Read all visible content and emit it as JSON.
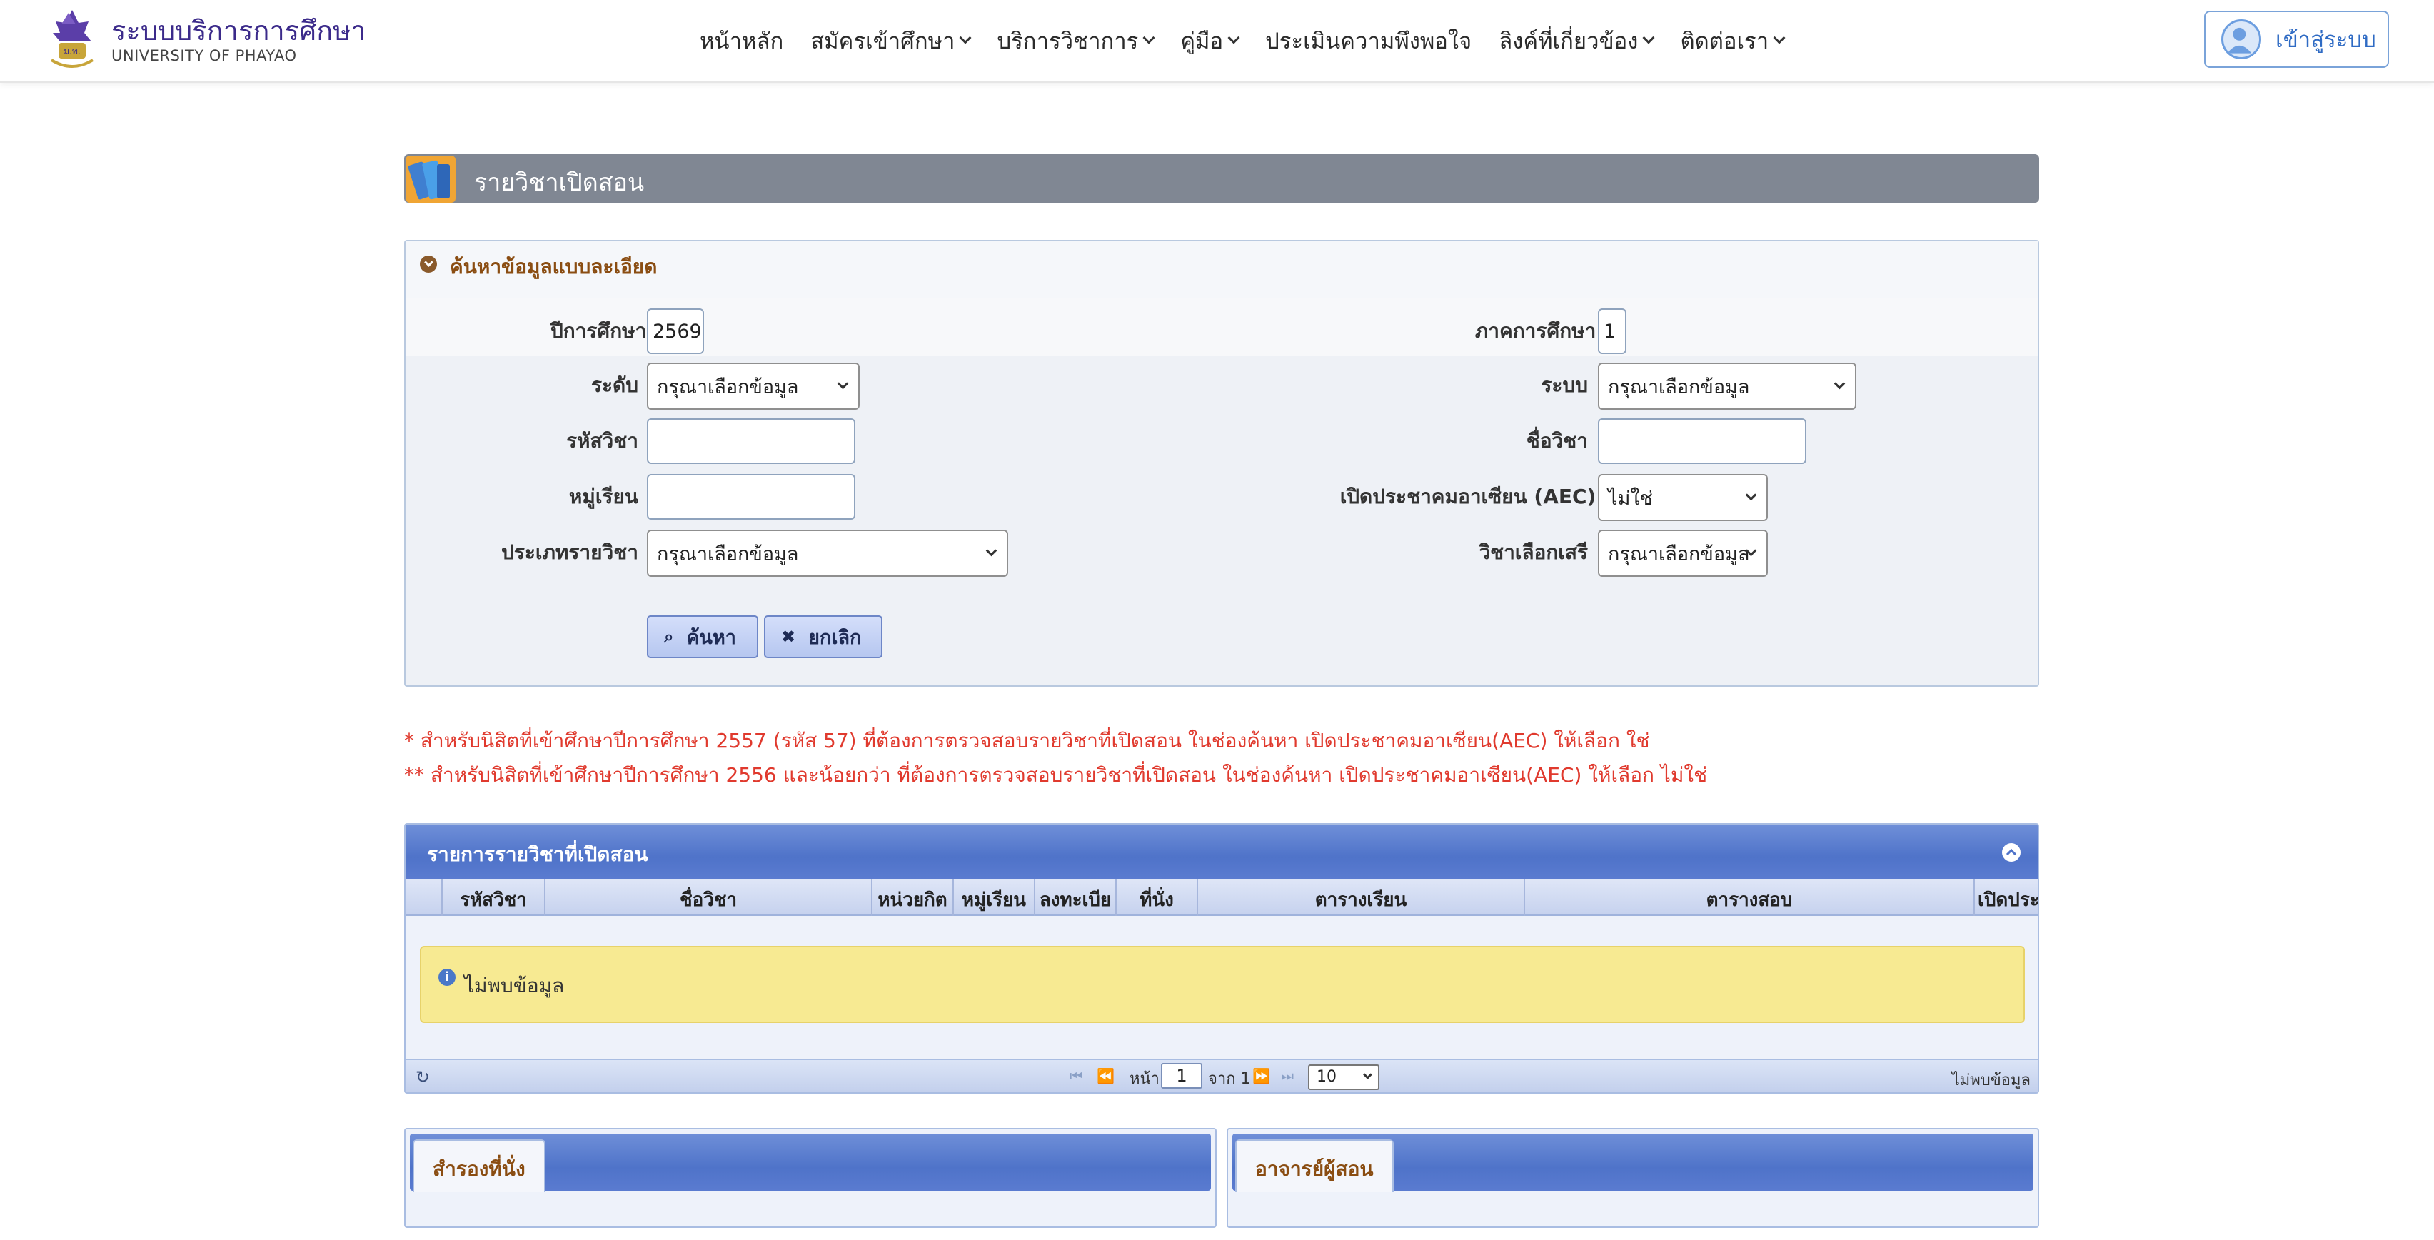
{
  "header": {
    "brand_th": "ระบบบริการการศึกษา",
    "brand_en": "UNIVERSITY OF PHAYAO",
    "nav": [
      {
        "label": "หน้าหลัก",
        "dropdown": false
      },
      {
        "label": "สมัครเข้าศึกษา",
        "dropdown": true
      },
      {
        "label": "บริการวิชาการ",
        "dropdown": true
      },
      {
        "label": "คู่มือ",
        "dropdown": true
      },
      {
        "label": "ประเมินความพึงพอใจ",
        "dropdown": false
      },
      {
        "label": "ลิงค์ที่เกี่ยวข้อง",
        "dropdown": true
      },
      {
        "label": "ติดต่อเรา",
        "dropdown": true
      }
    ],
    "login_label": "เข้าสู่ระบบ"
  },
  "page": {
    "title": "รายวิชาเปิดสอน"
  },
  "search": {
    "header": "ค้นหาข้อมูลแบบละเอียด",
    "required_mark": "*",
    "year_label": "ปีการศึกษา",
    "year_value": "2569",
    "term_label": "ภาคการศึกษา",
    "term_value": "1",
    "level_label": "ระดับ",
    "level_value": "กรุณาเลือกข้อมูล",
    "system_label": "ระบบ",
    "system_value": "กรุณาเลือกข้อมูล",
    "code_label": "รหัสวิชา",
    "code_value": "",
    "name_label": "ชื่อวิชา",
    "name_value": "",
    "section_label": "หมู่เรียน",
    "section_value": "",
    "aec_label": "เปิดประชาคมอาเซียน (AEC)",
    "aec_value": "ไม่ใช่",
    "type_label": "ประเภทรายวิชา",
    "type_value": "กรุณาเลือกข้อมูล",
    "elective_label": "วิชาเลือกเสรี",
    "elective_value": "กรุณาเลือกข้อมูล",
    "search_button": "ค้นหา",
    "cancel_button": "ยกเลิก"
  },
  "notes": [
    "*  สำหรับนิสิตที่เข้าศึกษาปีการศึกษา 2557 (รหัส 57) ที่ต้องการตรวจสอบรายวิชาที่เปิดสอน ในช่องค้นหา เปิดประชาคมอาเซียน(AEC) ให้เลือก ใช่",
    "** สำหรับนิสิตที่เข้าศึกษาปีการศึกษา 2556 และน้อยกว่า ที่ต้องการตรวจสอบรายวิชาที่เปิดสอน ในช่องค้นหา เปิดประชาคมอาเซียน(AEC) ให้เลือก ไม่ใช่"
  ],
  "grid": {
    "caption": "รายการรายวิชาที่เปิดสอน",
    "columns": [
      "",
      "รหัสวิชา",
      "ชื่อวิชา",
      "หน่วยกิต",
      "หมู่เรียน",
      "ลงทะเบีย",
      "ที่นั่ง",
      "ตารางเรียน",
      "ตารางสอบ",
      "เปิดประ"
    ],
    "empty_message": "ไม่พบข้อมูล",
    "pager": {
      "page_label": "หน้า",
      "page_value": "1",
      "of_label": "จาก 1",
      "rows_value": "10",
      "total_text": "ไม่พบข้อมูล"
    }
  },
  "bottom_tabs": {
    "reserve_label": "สำรองที่นั่ง",
    "instructor_label": "อาจารย์ผู้สอน"
  },
  "colors": {
    "title_bar": "#808793",
    "accent_blue": "#4f73c9",
    "note_red": "#e03a2e",
    "warning_bg": "#f7ea92",
    "brand_purple": "#3b2a8a"
  },
  "icons": {
    "logo": "university-seal-icon",
    "login": "user-avatar-icon",
    "title": "books-icon",
    "search": "magnifier-icon",
    "cancel": "x-icon",
    "info": "info-icon",
    "refresh": "refresh-icon"
  }
}
